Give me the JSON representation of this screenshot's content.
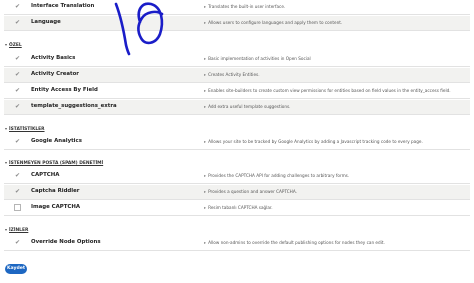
{
  "colors": {
    "accent": "#1d67c2",
    "scribble": "#1a1dc8",
    "row_alt": "#f2f2f0"
  },
  "top_rows": [
    {
      "name": "Interface Translation",
      "description": "Translates the built-in user interface.",
      "checked": true
    },
    {
      "name": "Language",
      "description": "Allows users to configure languages and apply them to content.",
      "checked": true
    }
  ],
  "sections": [
    {
      "title": "ÖZEL",
      "rows": [
        {
          "name": "Activity Basics",
          "description": "Basic implementation of activities in Open Social",
          "checked": true
        },
        {
          "name": "Activity Creator",
          "description": "Creates Activity Entities.",
          "checked": true
        },
        {
          "name": "Entity Access By Field",
          "description": "Enables site-builders to create custom view permissions for entities based on field values in the entity_access field.",
          "checked": true
        },
        {
          "name": "template_suggestions_extra",
          "description": "Add extra useful template suggestions.",
          "checked": true
        }
      ]
    },
    {
      "title": "İSTATİSTİKLER",
      "rows": [
        {
          "name": "Google Analytics",
          "description": "Allows your site to be tracked by Google Analytics by adding a Javascript tracking code to every page.",
          "checked": true
        }
      ]
    },
    {
      "title": "İSTENMEYEN POSTA (SPAM) DENETİMİ",
      "rows": [
        {
          "name": "CAPTCHA",
          "description": "Provides the CAPTCHA API for adding challenges to arbitrary forms.",
          "checked": true
        },
        {
          "name": "Captcha Riddler",
          "description": "Provides a question and answer CAPTCHA.",
          "checked": true
        },
        {
          "name": "Image CAPTCHA",
          "description": "Resim tabanlı CAPTCHA sağlar.",
          "checked": false
        }
      ]
    },
    {
      "title": "İZİNLER",
      "rows": [
        {
          "name": "Override Node Options",
          "description": "Allow non-admins to override the default publishing options for nodes they can edit.",
          "checked": true
        }
      ]
    }
  ],
  "save_label": "Kaydet",
  "check_glyph": "✔",
  "arrow_glyph": "▸",
  "caret_glyph": "▾"
}
